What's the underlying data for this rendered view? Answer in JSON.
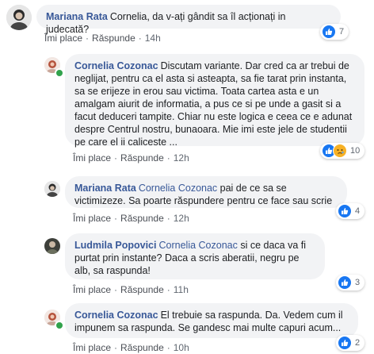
{
  "colors": {
    "link": "#385898",
    "bubble": "#f2f3f5",
    "like": "#1877f2",
    "sad": "#f7b125",
    "online": "#31a24c"
  },
  "comments": [
    {
      "author": "Mariana Rata",
      "tag": "",
      "text": "Cornelia, da v-ați gândit sa îl acționați in judecată?",
      "actions": {
        "like": "Îmi place",
        "reply": "Răspunde",
        "time": "14h"
      },
      "reactions": {
        "icons": [
          "like-icon"
        ],
        "count": "7"
      }
    },
    {
      "author": "Cornelia Cozonac",
      "tag": "",
      "text": "Discutam variante. Dar cred ca ar trebui de neglijat, pentru ca el asta si asteapta, sa fie tarat prin instanta, sa se erijeze in erou sau victima. Toata cartea asta e un amalgam aiurit de informatia, a pus ce si pe unde a gasit si a facut deduceri tampite. Chiar nu este logica e ceea ce e adunat despre Centrul nostru, bunaoara. Mie imi este jele de studentii pe care el ii caliceste ...",
      "actions": {
        "like": "Îmi place",
        "reply": "Răspunde",
        "time": "12h"
      },
      "reactions": {
        "icons": [
          "like-icon",
          "sad-icon"
        ],
        "count": "10"
      }
    },
    {
      "author": "Mariana Rata",
      "tag": "Cornelia Cozonac",
      "text": "pai de ce sa se victimizeze. Sa poarte răspundere pentru ce face sau scrie",
      "actions": {
        "like": "Îmi place",
        "reply": "Răspunde",
        "time": "12h"
      },
      "reactions": {
        "icons": [
          "like-icon"
        ],
        "count": "4"
      }
    },
    {
      "author": "Ludmila Popovici",
      "tag": "Cornelia Cozonac",
      "text": "si ce daca va fi purtat prin instante? Daca a scris aberatii, negru pe alb, sa raspunda!",
      "actions": {
        "like": "Îmi place",
        "reply": "Răspunde",
        "time": "11h"
      },
      "reactions": {
        "icons": [
          "like-icon"
        ],
        "count": "3"
      }
    },
    {
      "author": "Cornelia Cozonac",
      "tag": "",
      "text": "El trebuie sa raspunda. Da. Vedem cum il impunem sa raspunda. Se gandesc mai multe capuri acum...",
      "actions": {
        "like": "Îmi place",
        "reply": "Răspunde",
        "time": "10h"
      },
      "reactions": {
        "icons": [
          "like-icon"
        ],
        "count": "2"
      }
    }
  ]
}
